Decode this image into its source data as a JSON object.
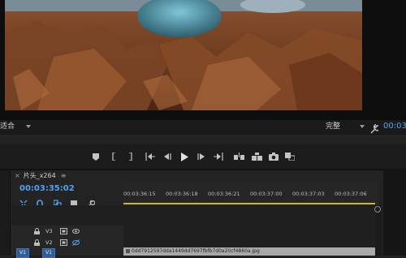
{
  "monitor": {
    "fit_dropdown": "适合",
    "quality_dropdown": "完整",
    "timecode": "00:03:4"
  },
  "sequence": {
    "tab_label": "片头_x264",
    "timecode": "00:03:35:02"
  },
  "ruler": {
    "ticks": [
      "00:03:36:15",
      "00:03:36:18",
      "00:03:36:21",
      "00:03:37:00",
      "00:03:37:03",
      "00:03:37:06"
    ]
  },
  "tracks": {
    "v3": "V3",
    "v2": "V2",
    "v1": "V1"
  },
  "clip": {
    "filename": "0dd7912597dda1449dd7697fbfb7d0a20cf4860a.jpg"
  },
  "colors": {
    "accent_timecode": "#4fa3f5",
    "playhead_range": "#c8b93a"
  }
}
